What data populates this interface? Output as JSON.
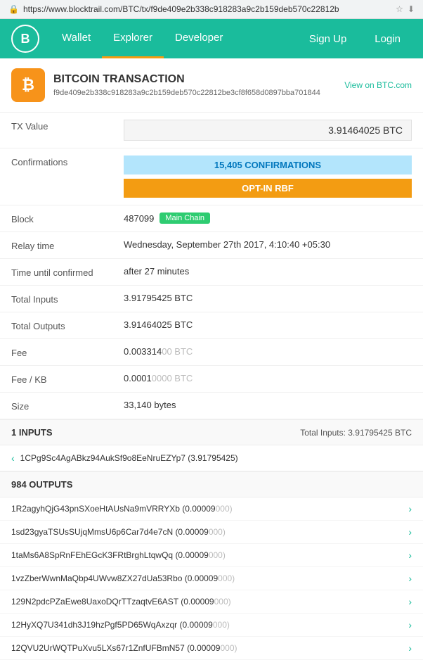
{
  "url": "https://www.blocktrail.com/BTC/tx/f9de409e2b338c918283a9c2b159deb570c22812b",
  "nav": {
    "logo": "B",
    "links": [
      "Wallet",
      "Explorer",
      "Developer"
    ],
    "active_link": "Explorer",
    "right_links": [
      "Sign Up",
      "Login"
    ]
  },
  "transaction": {
    "icon": "₿",
    "title": "BITCOIN TRANSACTION",
    "view_link": "View on BTC.com",
    "hash": "f9de409e2b338c918283a9c2b159deb570c22812be3cf8f658d0897bba701844",
    "fields": {
      "tx_value_label": "TX Value",
      "tx_value": "3.91464025 BTC",
      "confirmations_label": "Confirmations",
      "confirmations": "15,405 CONFIRMATIONS",
      "rbf": "OPT-IN RBF",
      "block_label": "Block",
      "block_number": "487099",
      "block_badge": "Main Chain",
      "relay_label": "Relay time",
      "relay_value": "Wednesday, September 27th 2017, 4:10:40 +05:30",
      "time_label": "Time until confirmed",
      "time_value": "after 27 minutes",
      "total_inputs_label": "Total Inputs",
      "total_inputs_value": "3.91795425 BTC",
      "total_outputs_label": "Total Outputs",
      "total_outputs_value": "3.91464025 BTC",
      "fee_label": "Fee",
      "fee_value": "0.003314",
      "fee_fade": "00 BTC",
      "fee_kb_label": "Fee / KB",
      "fee_kb_value": "0.0001",
      "fee_kb_fade": "0000 BTC",
      "size_label": "Size",
      "size_value": "33,140 bytes"
    }
  },
  "inputs_section": {
    "title": "1 INPUTS",
    "total": "Total Inputs: 3.91795425 BTC",
    "items": [
      {
        "address": "1CPg9Sc4AgABkz94AukSf9o8EeNruEZYp7 (3.91795425)"
      }
    ]
  },
  "outputs_section": {
    "title": "984 OUTPUTS",
    "items": [
      {
        "address": "1R2agyhQjG43pnSXoeHtAUsNa9mVRRYXb (0.00009",
        "fade": "000)"
      },
      {
        "address": "1sd23gyaTSUsSUjqMmsU6p6Car7d4e7cN (0.00009",
        "fade": "000)"
      },
      {
        "address": "1taMs6A8SpRnFEhEGcK3FRtBrghLtqwQq (0.00009",
        "fade": "000)"
      },
      {
        "address": "1vzZberWwnMaQbp4UWvw8ZX27dUa53Rbo (0.00009",
        "fade": "000)"
      },
      {
        "address": "129N2pdcPZaEwe8UaxoDQrTTzaqtvE6AST (0.00009",
        "fade": "000)"
      },
      {
        "address": "12HyXQ7U341dh3J19hzPgf5PD65WqAxzqr (0.00009",
        "fade": "000)"
      },
      {
        "address": "12QVU2UrWQTPuXvu5LXs67r1ZnfUFBmN57 (0.00009",
        "fade": "000)"
      }
    ]
  }
}
